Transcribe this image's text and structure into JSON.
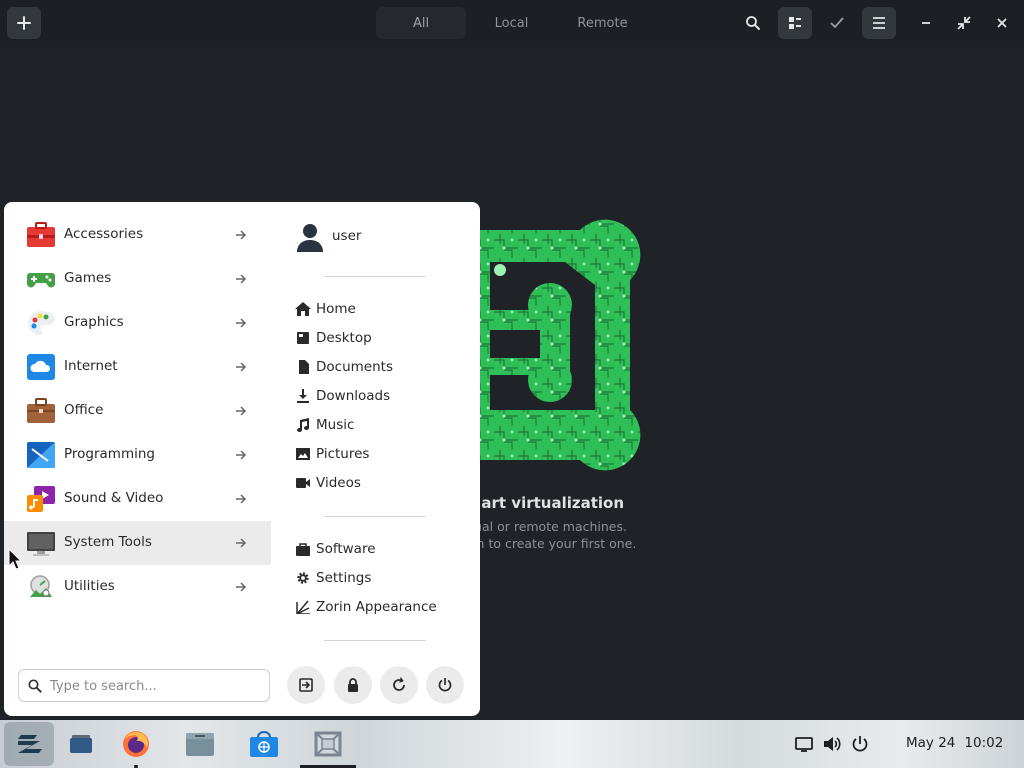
{
  "headerbar": {
    "view_tabs": [
      {
        "label": "All",
        "active": true
      },
      {
        "label": "Local",
        "active": false
      },
      {
        "label": "Remote",
        "active": false
      }
    ],
    "icons": [
      "add-icon",
      "search-icon",
      "list-view-icon",
      "select-check-icon",
      "hamburger-menu-icon",
      "minimize-icon",
      "restore-icon",
      "close-icon"
    ]
  },
  "empty_state": {
    "title": "e art virtualization",
    "line1": "rtual or remote machines.",
    "line2": "ton to create your first one."
  },
  "menu": {
    "categories": [
      {
        "label": "Accessories",
        "icon": "accessories-toolbox-icon"
      },
      {
        "label": "Games",
        "icon": "games-gamepad-icon"
      },
      {
        "label": "Graphics",
        "icon": "graphics-palette-icon"
      },
      {
        "label": "Internet",
        "icon": "internet-cloud-icon"
      },
      {
        "label": "Office",
        "icon": "office-briefcase-icon"
      },
      {
        "label": "Programming",
        "icon": "programming-icon"
      },
      {
        "label": "Sound & Video",
        "icon": "sound-video-icon"
      },
      {
        "label": "System Tools",
        "icon": "system-tools-monitor-icon",
        "hovered": true
      },
      {
        "label": "Utilities",
        "icon": "utilities-icon"
      }
    ],
    "user": {
      "name": "user"
    },
    "places": [
      {
        "label": "Home",
        "icon": "home-icon"
      },
      {
        "label": "Desktop",
        "icon": "desktop-icon"
      },
      {
        "label": "Documents",
        "icon": "documents-icon"
      },
      {
        "label": "Downloads",
        "icon": "downloads-icon"
      },
      {
        "label": "Music",
        "icon": "music-icon"
      },
      {
        "label": "Pictures",
        "icon": "pictures-icon"
      },
      {
        "label": "Videos",
        "icon": "videos-icon"
      }
    ],
    "system": [
      {
        "label": "Software",
        "icon": "software-bag-icon"
      },
      {
        "label": "Settings",
        "icon": "settings-gear-icon"
      },
      {
        "label": "Zorin Appearance",
        "icon": "appearance-icon"
      }
    ],
    "search": {
      "placeholder": "Type to search..."
    },
    "session_buttons": [
      "logout-icon",
      "lock-icon",
      "restart-icon",
      "power-icon"
    ]
  },
  "taskbar": {
    "apps": [
      "zorin-start-icon",
      "workspaces-icon",
      "firefox-icon",
      "files-icon",
      "software-store-icon",
      "boxes-icon"
    ],
    "tray": [
      "display-icon",
      "volume-icon",
      "power-icon"
    ],
    "date": "May 24",
    "time": "10:02"
  },
  "colors": {
    "window_bg": "#1f2327",
    "headerbar_bg": "#1c1f23",
    "menu_bg": "#ffffff",
    "hover_row": "#ebebeb",
    "hero_green": "#2fbf58"
  }
}
